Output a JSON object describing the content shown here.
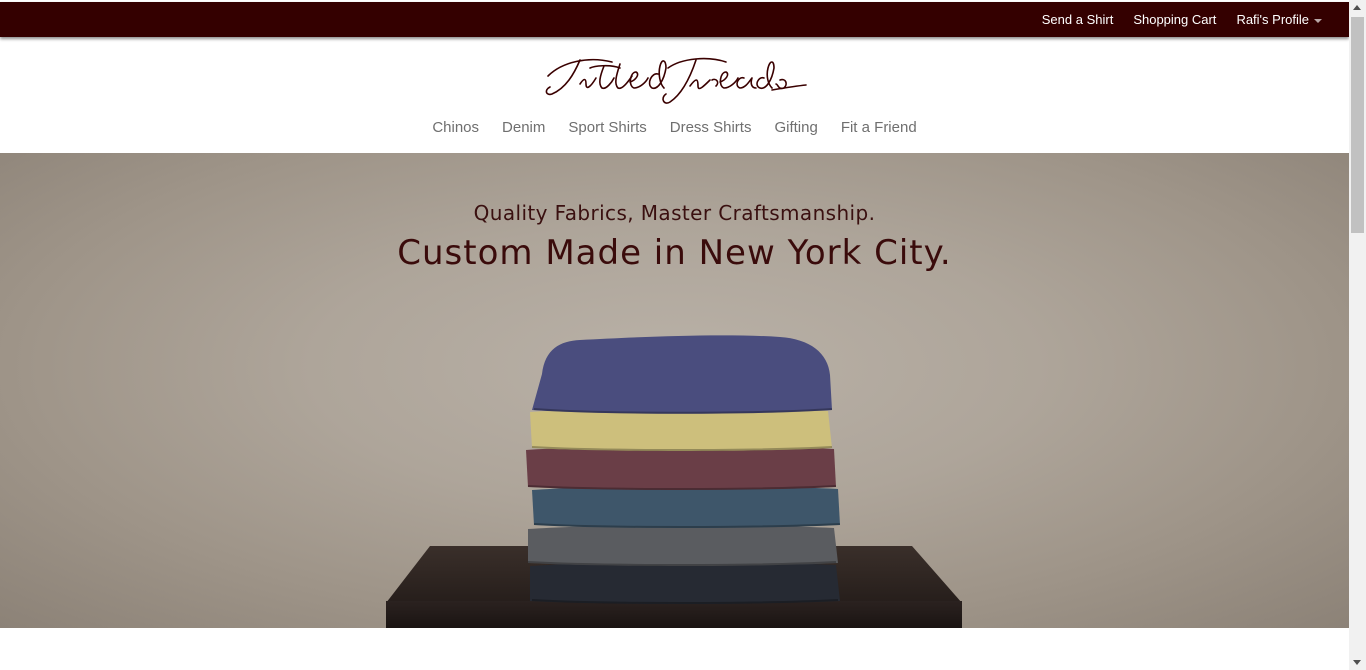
{
  "topbar": {
    "links": [
      "Send a Shirt",
      "Shopping Cart",
      "Rafi's Profile"
    ]
  },
  "logo": {
    "text": "Fitted Threads"
  },
  "nav": {
    "items": [
      "Chinos",
      "Denim",
      "Sport Shirts",
      "Dress Shirts",
      "Gifting",
      "Fit a Friend"
    ]
  },
  "hero": {
    "subtitle": "Quality Fabrics, Master Craftsmanship.",
    "title": "Custom Made in New York City."
  },
  "colors": {
    "topbar_bg": "#340000",
    "accent": "#3a0b0b",
    "nav_text": "#6f6f6f",
    "fabric_navy": "#4a4d7e",
    "fabric_yellow": "#cdbf7c",
    "fabric_maroon": "#6a3e47",
    "fabric_teal": "#3e566a",
    "fabric_gray": "#5a5c60",
    "fabric_black": "#262a33"
  }
}
